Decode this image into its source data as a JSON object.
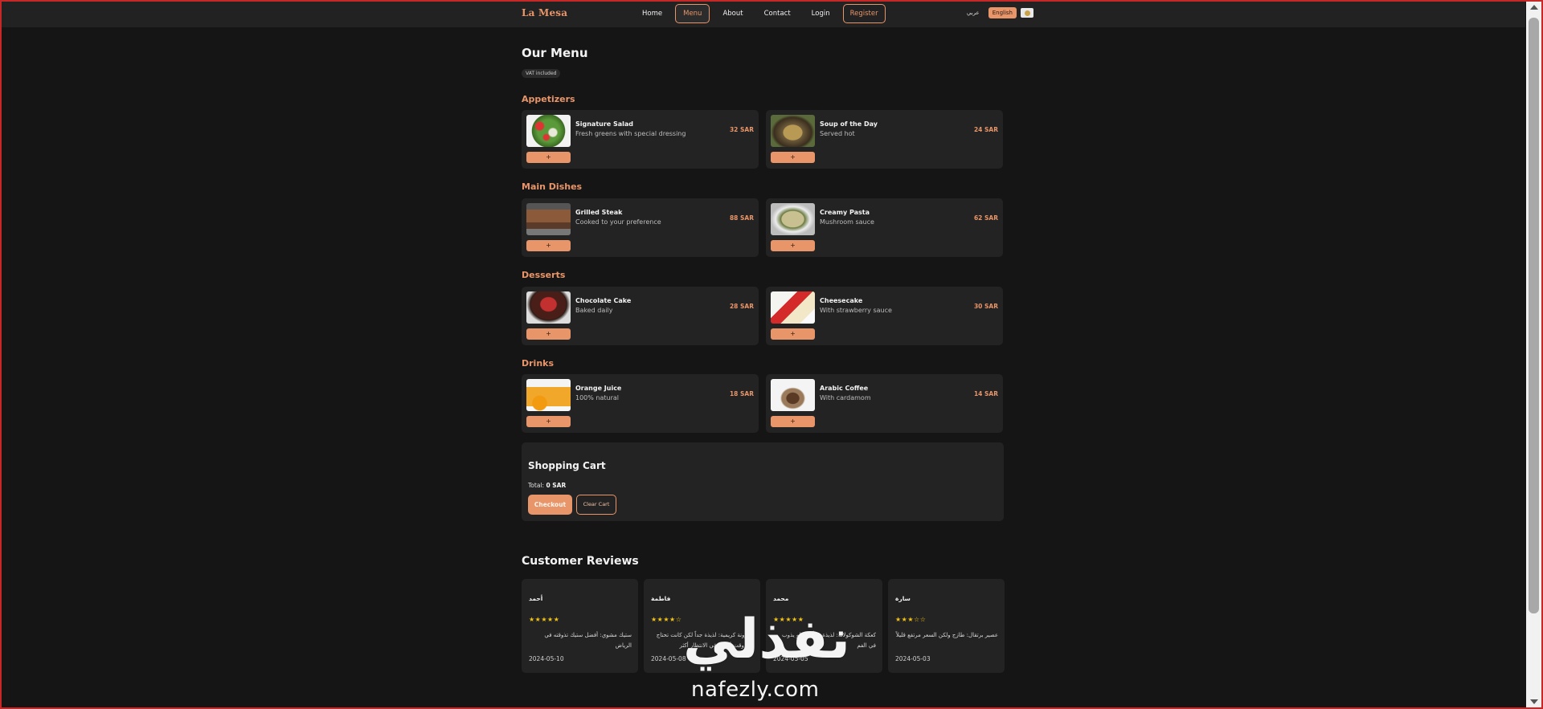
{
  "brand": "La Mesa",
  "nav": {
    "home": "Home",
    "menu": "Menu",
    "about": "About",
    "contact": "Contact",
    "login": "Login",
    "register": "Register"
  },
  "lang": {
    "arabic": "عربي",
    "english": "English"
  },
  "menu": {
    "title": "Our Menu",
    "vat_badge": "VAT included",
    "add_label": "+",
    "categories": [
      {
        "title": "Appetizers",
        "items": [
          {
            "name": "Signature Salad",
            "desc": "Fresh greens with special dressing",
            "price": "32 SAR"
          },
          {
            "name": "Soup of the Day",
            "desc": "Served hot",
            "price": "24 SAR"
          }
        ]
      },
      {
        "title": "Main Dishes",
        "items": [
          {
            "name": "Grilled Steak",
            "desc": "Cooked to your preference",
            "price": "88 SAR"
          },
          {
            "name": "Creamy Pasta",
            "desc": "Mushroom sauce",
            "price": "62 SAR"
          }
        ]
      },
      {
        "title": "Desserts",
        "items": [
          {
            "name": "Chocolate Cake",
            "desc": "Baked daily",
            "price": "28 SAR"
          },
          {
            "name": "Cheesecake",
            "desc": "With strawberry sauce",
            "price": "30 SAR"
          }
        ]
      },
      {
        "title": "Drinks",
        "items": [
          {
            "name": "Orange Juice",
            "desc": "100% natural",
            "price": "18 SAR"
          },
          {
            "name": "Arabic Coffee",
            "desc": "With cardamom",
            "price": "14 SAR"
          }
        ]
      }
    ]
  },
  "cart": {
    "title": "Shopping Cart",
    "total_label": "Total:",
    "total_value": "0 SAR",
    "checkout": "Checkout",
    "clear": "Clear Cart"
  },
  "reviews": {
    "title": "Customer Reviews",
    "items": [
      {
        "name": "أحمد",
        "stars": "★★★★★",
        "text": "ستيك مشوي: أفضل ستيك تذوقته في الرياض",
        "date": "2024-05-10"
      },
      {
        "name": "فاطمة",
        "stars": "★★★★☆",
        "text": "مكرونة كريمية: لذيذة جداً لكن كانت تحتاج إلى وقت أطول في الانتظار أكثر",
        "date": "2024-05-08"
      },
      {
        "name": "محمد",
        "stars": "★★★★★",
        "text": "كعكة الشوكولاتة: لذيذة جداً والحلو يذوب في الفم",
        "date": "2024-05-05"
      },
      {
        "name": "سارة",
        "stars": "★★★☆☆",
        "text": "عصير برتقال: طازج ولكن السعر مرتفع قليلاً",
        "date": "2024-05-03"
      }
    ]
  },
  "watermark": {
    "logo": "نفذلي",
    "url": "nafezly.com"
  },
  "colors": {
    "accent": "#e8956a",
    "background": "#151515",
    "card": "#232323",
    "star": "#f3c316"
  }
}
